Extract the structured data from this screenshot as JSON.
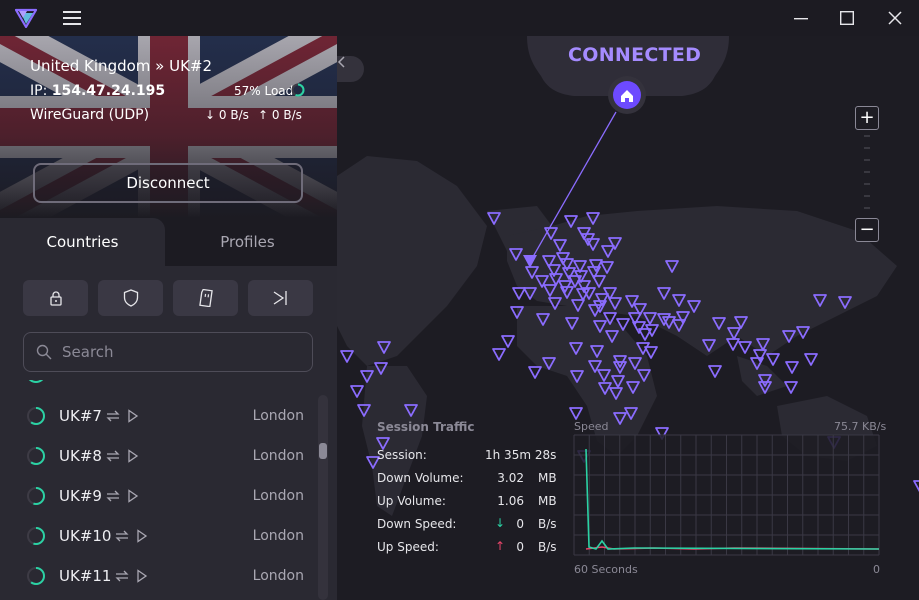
{
  "header": {
    "logo_icon": "proton-vpn-logo",
    "menu_icon": "hamburger-menu-icon",
    "window_controls": [
      "minimize-icon",
      "maximize-icon",
      "close-icon"
    ]
  },
  "connection": {
    "server": "United Kingdom » UK#2",
    "ip_label": "IP:",
    "ip": "154.47.24.195",
    "load": "57% Load",
    "load_fraction": 0.57,
    "protocol": "WireGuard (UDP)",
    "down_rate": "0 B/s",
    "up_rate": "0 B/s",
    "disconnect_label": "Disconnect"
  },
  "tabs": [
    {
      "label": "Countries",
      "active": true
    },
    {
      "label": "Profiles",
      "active": false
    }
  ],
  "filters": [
    {
      "icon": "lock-icon"
    },
    {
      "icon": "shield-icon"
    },
    {
      "icon": "sd-card-icon"
    },
    {
      "icon": "tor-arrow-icon"
    }
  ],
  "search": {
    "placeholder": "Search"
  },
  "servers": [
    {
      "name": "UK#7",
      "city": "London",
      "load": 0.6
    },
    {
      "name": "UK#8",
      "city": "London",
      "load": 0.6
    },
    {
      "name": "UK#9",
      "city": "London",
      "load": 0.55
    },
    {
      "name": "UK#10",
      "city": "London",
      "load": 0.55
    },
    {
      "name": "UK#11",
      "city": "London",
      "load": 0.6
    }
  ],
  "map": {
    "status": "CONNECTED",
    "home_icon": "home-icon",
    "zoom_in": "+",
    "zoom_out": "−",
    "accent": "#7c5cff"
  },
  "session_traffic": {
    "title": "Session Traffic",
    "rows": [
      {
        "label": "Session:",
        "value": "1h 35m 28s",
        "unit": ""
      },
      {
        "label": "Down Volume:",
        "value": "3.02",
        "unit": "MB"
      },
      {
        "label": "Up Volume:",
        "value": "1.06",
        "unit": "MB"
      },
      {
        "label": "Down Speed:",
        "value": "0",
        "unit": "B/s"
      },
      {
        "label": "Up Speed:",
        "value": "0",
        "unit": "B/s"
      }
    ]
  },
  "speed_chart": {
    "title": "Speed",
    "max_label": "75.7 KB/s",
    "x_left": "60 Seconds",
    "x_right": "0",
    "down_color": "#2bd2a4",
    "up_color": "#e8456a"
  }
}
